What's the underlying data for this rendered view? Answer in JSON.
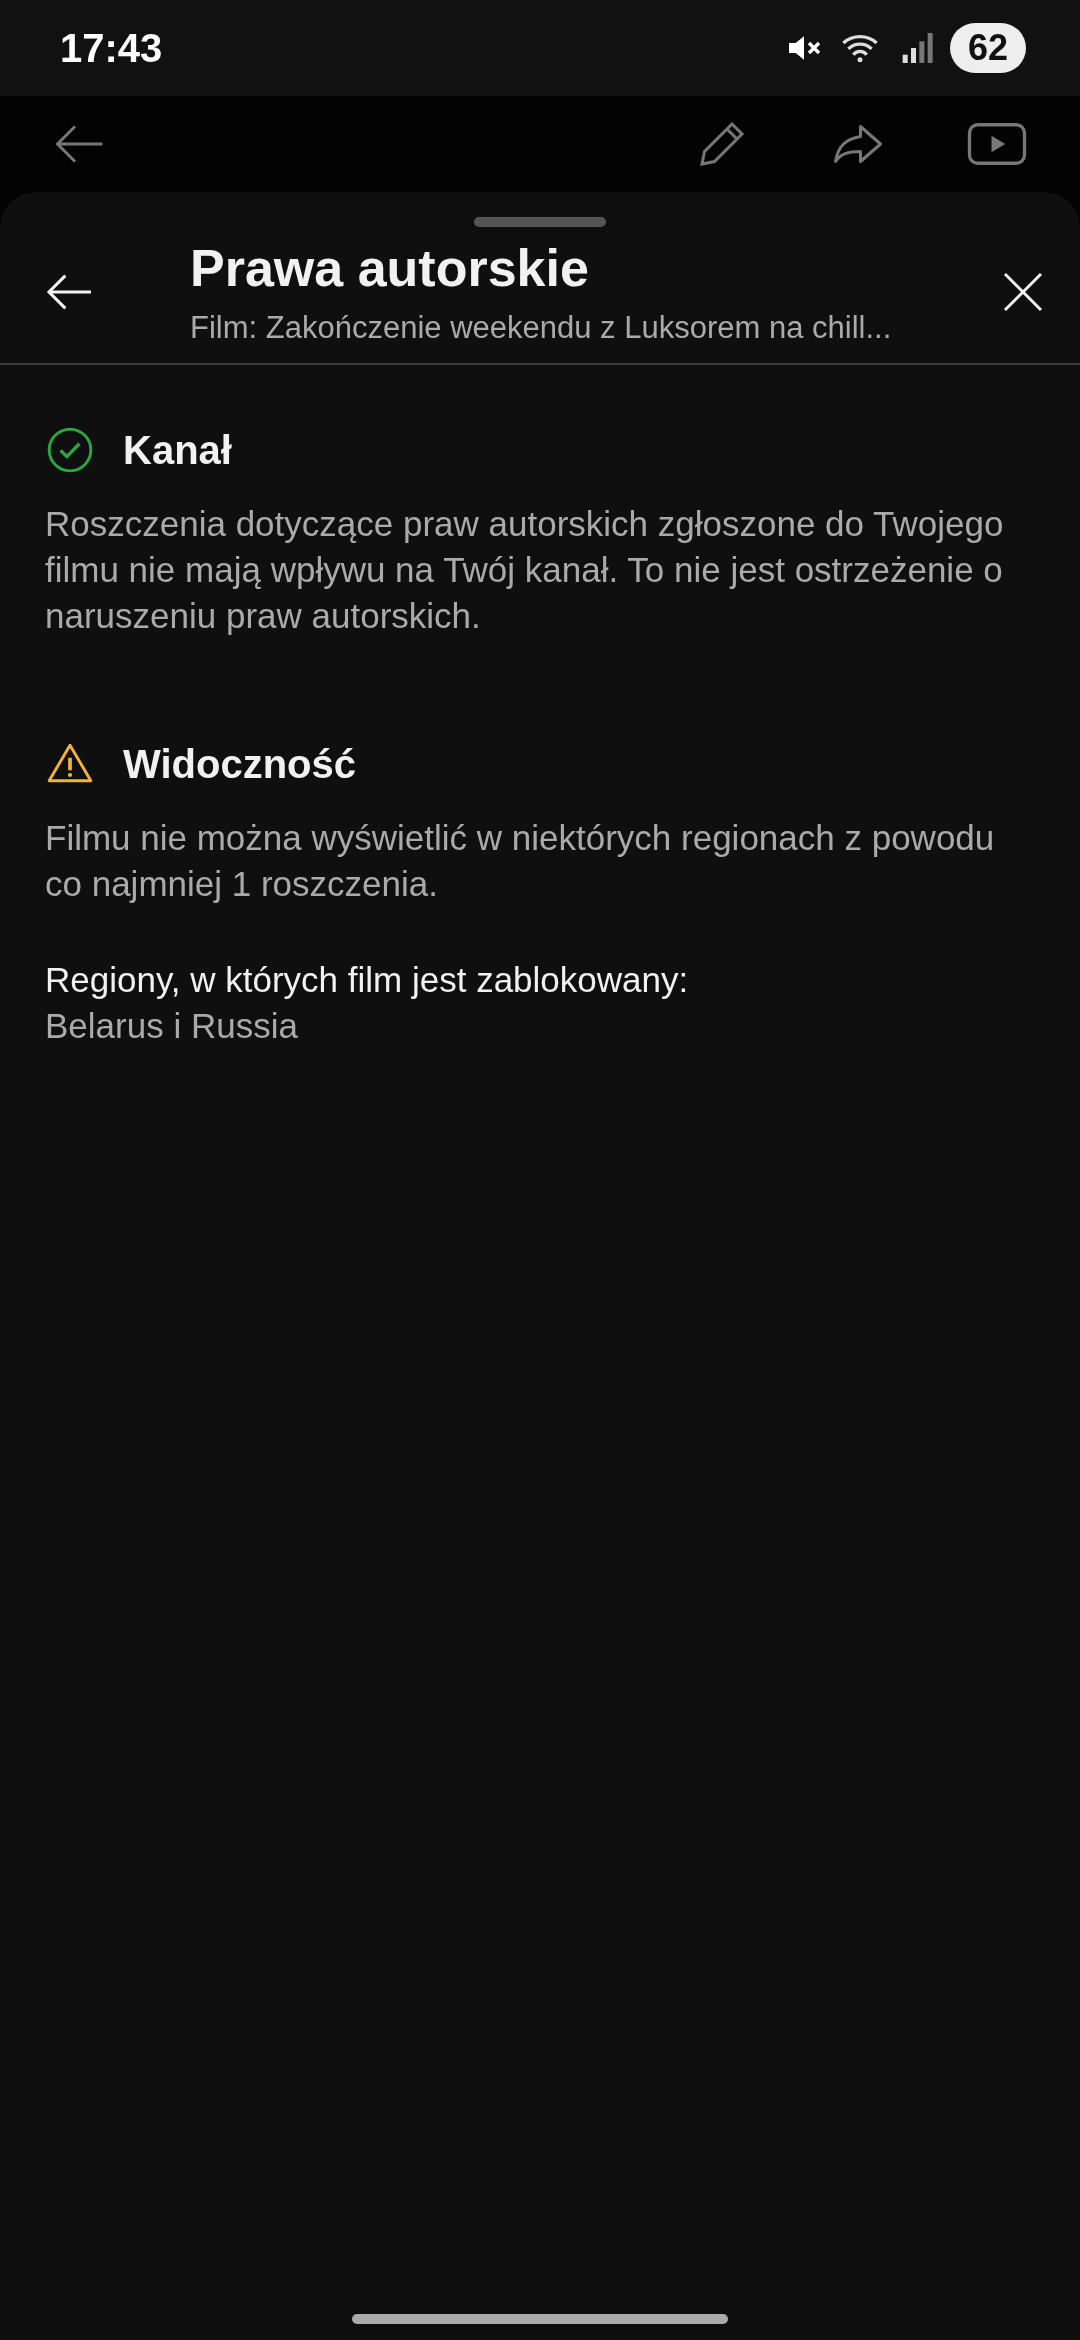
{
  "status_bar": {
    "time": "17:43",
    "battery": "62"
  },
  "sheet": {
    "title": "Prawa autorskie",
    "subtitle": "Film: Zakończenie weekendu z Luksorem na chill..."
  },
  "sections": [
    {
      "kind": "success",
      "title": "Kanał",
      "body": "Roszczenia dotyczące praw autorskich zgłoszone do Twojego filmu nie mają wpływu na Twój kanał. To nie jest ostrzeżenie o naruszeniu praw autorskich."
    },
    {
      "kind": "warning",
      "title": "Widoczność",
      "body": "Filmu nie można wyświetlić w niektórych regionach z powodu co najmniej 1 roszczenia.",
      "label": "Regiony, w których film jest zablokowany:",
      "value": "Belarus i Russia"
    }
  ]
}
